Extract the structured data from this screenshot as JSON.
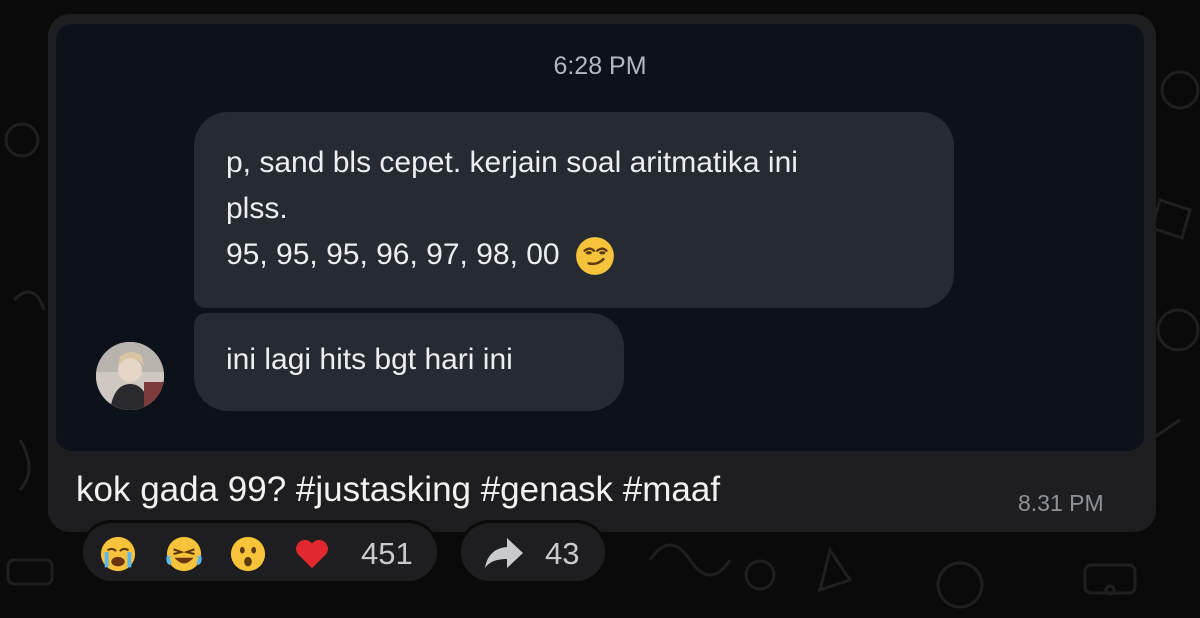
{
  "colors": {
    "background": "#0a0a0a",
    "post_card": "#1e1e20",
    "screenshot_bg": "#0d111a",
    "bubble": "#262a31",
    "heart": "#e0282e"
  },
  "screenshot": {
    "time": "6:28 PM",
    "messages": [
      {
        "lines": [
          "p, sand bls cepet. kerjain soal aritmatika ini",
          "plss.",
          "95, 95, 95, 96, 97, 98, 00"
        ],
        "emoji": "smirk-emoji"
      },
      {
        "lines": [
          "ini lagi hits bgt hari ini"
        ]
      }
    ],
    "avatar": "sender-avatar"
  },
  "post": {
    "caption": "kok gada 99? #justasking #genask #maaf",
    "time": "8.31 PM"
  },
  "reactions": {
    "icons": [
      "crying-emoji",
      "laughing-emoji",
      "surprised-emoji",
      "heart-emoji"
    ],
    "count": "451"
  },
  "shares": {
    "icon": "forward-arrow-icon",
    "count": "43"
  }
}
